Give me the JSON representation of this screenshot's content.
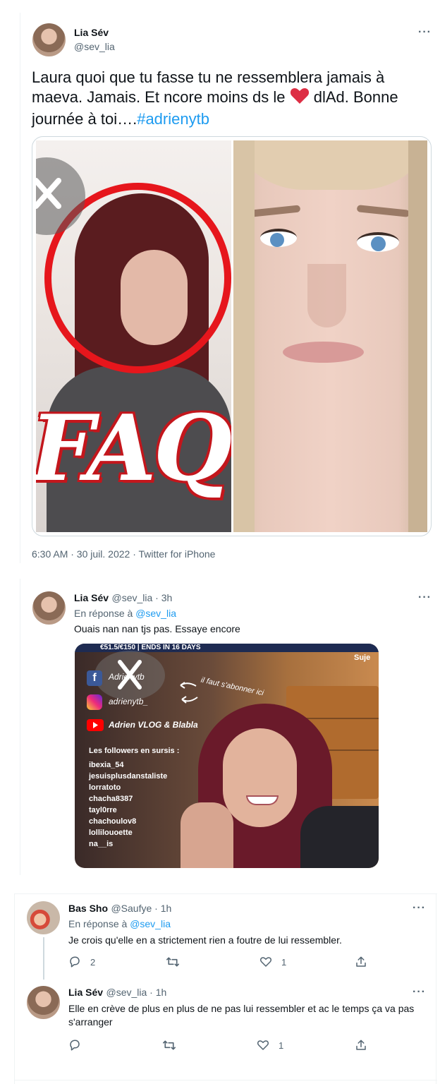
{
  "main_tweet": {
    "name": "Lia Sév",
    "handle": "@sev_lia",
    "text_parts": [
      "Laura quoi que tu fasse tu ne ressemblera jamais à maeva. Jamais. Et ncore moins ds le ",
      " dlAd. Bonne journée à toi….",
      "#adrienytb"
    ],
    "image_left_text": "FAQ",
    "timestamp": "6:30 AM · 30 juil. 2022 · Twitter for iPhone"
  },
  "reply1": {
    "name": "Lia Sév",
    "handle_time": "@sev_lia · 3h",
    "reply_prefix": "En réponse à",
    "reply_to": "@sev_lia",
    "text": "Ouais nan nan tjs pas. Essaye encore",
    "screenshot": {
      "top_banner": "€51.5/€150 | ENDS IN 16 DAYS",
      "corner_text": "Suje",
      "facebook_handle": "Adrienytb",
      "instagram_handle": "adrienytb_",
      "youtube_label": "Adrien VLOG & Blabla",
      "handwritten_note": "il faut s'abonner ici",
      "followers_title": "Les followers en sursis :",
      "followers": [
        "ibexia_54",
        "jesuisplusdanstaliste",
        "lorratoto",
        "chacha8387",
        "tayl0rre",
        "chachoulov8",
        "lollilouoette",
        "na__is"
      ]
    }
  },
  "reply2": {
    "name": "Bas Sho",
    "handle_time": "@Saufye · 1h",
    "reply_prefix": "En réponse à",
    "reply_to": "@sev_lia",
    "text": "Je crois qu'elle en a strictement rien a foutre de lui ressembler.",
    "reply_count": "2",
    "like_count": "1"
  },
  "reply3": {
    "name": "Lia Sév",
    "handle_time": "@sev_lia · 1h",
    "text": "Elle en crève de plus en plus de ne pas lui ressembler et ac le temps ça va pas s'arranger",
    "like_count": "1"
  },
  "colors": {
    "accent": "#1d9bf0",
    "text": "#0f1419",
    "secondary": "#536471",
    "heart": "#e0245e"
  }
}
